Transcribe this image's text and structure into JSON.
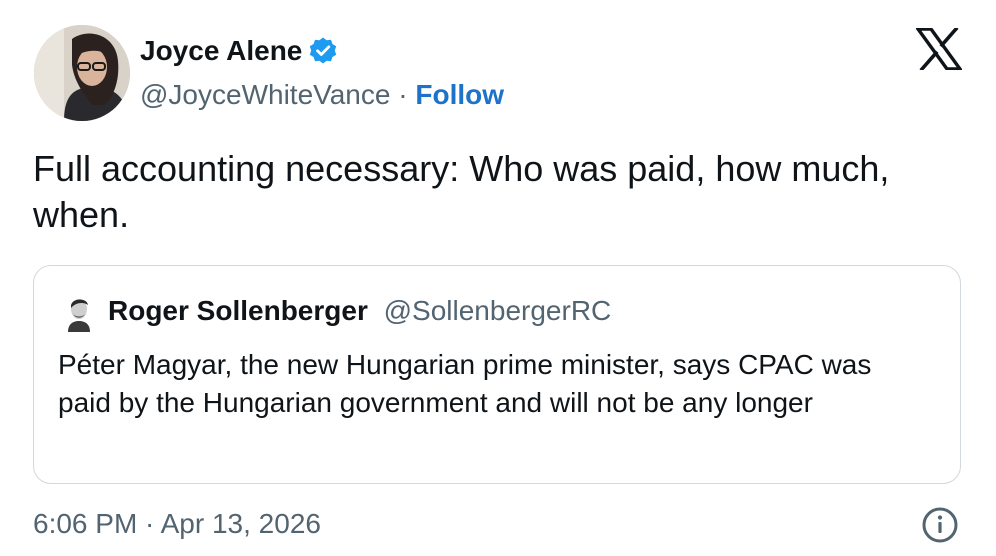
{
  "author": {
    "display_name": "Joyce Alene",
    "handle": "@JoyceWhiteVance",
    "separator": "·",
    "follow_label": "Follow",
    "verified": true
  },
  "tweet": {
    "text": "Full accounting necessary: Who was paid, how much, when.",
    "timestamp": "6:06 PM · Apr 13, 2026"
  },
  "quoted_tweet": {
    "display_name": "Roger Sollenberger",
    "handle": "@SollenbergerRC",
    "text": "Péter Magyar, the new Hungarian prime minister, says CPAC was paid by the Hungarian government and will not be any longer"
  },
  "icons": {
    "verified": "verified-badge-icon",
    "brand": "x-logo-icon",
    "info": "info-icon"
  },
  "colors": {
    "link": "#1d73c9",
    "verified": "#1d9bf0",
    "secondary_text": "#536471",
    "border": "#cfd9de"
  }
}
